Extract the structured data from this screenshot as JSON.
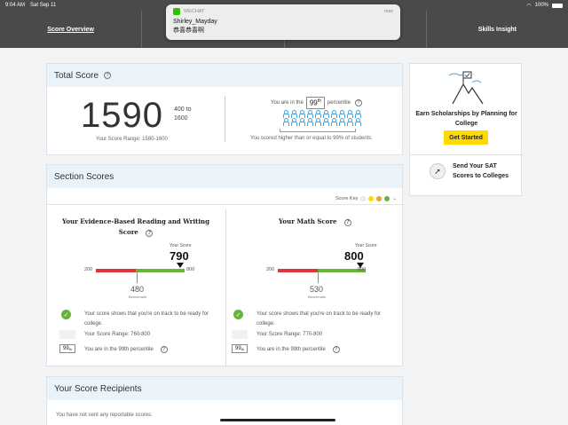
{
  "status_bar": {
    "time": "9:04 AM",
    "date": "Sat Sep 11",
    "battery": "100%"
  },
  "nav": {
    "tabs": [
      {
        "label": "Score Overview"
      },
      {
        "label": ""
      },
      {
        "label": ""
      },
      {
        "label": "Skills Insight"
      }
    ]
  },
  "notification": {
    "app": "WECHAT",
    "time": "now",
    "sender": "Shirley_Mayday",
    "message": "恭喜恭喜啊"
  },
  "total": {
    "title": "Total Score",
    "score": "1590",
    "range_top": "400 to",
    "range_bottom": "1600",
    "score_range": "Your Score Range: 1580-1600",
    "percentile_prefix": "You are in the",
    "percentile": "99",
    "percentile_sup": "th",
    "percentile_suffix": "percentile",
    "caption": "You scored higher than or equal to 99% of students."
  },
  "sidebar": {
    "title": "Earn Scholarships by Planning for College",
    "button": "Get Started",
    "send_text": "Send Your SAT Scores to Colleges"
  },
  "section": {
    "title": "Section Scores",
    "score_key": "Score Key",
    "key_colors": [
      "#f0f0f0",
      "#fedb00",
      "#e8a23b",
      "#66b538"
    ],
    "reading": {
      "title": "Your Evidence-Based Reading and Writing Score",
      "your_score_label": "Your Score",
      "score": "790",
      "min": "200",
      "max": "800",
      "benchmark": "480",
      "benchmark_label": "Benchmark",
      "on_track": "Your score shows that you're on track to be ready for college.",
      "range": "Your Score Range: 760-800",
      "pct_box": "99",
      "pct_sup": "th",
      "pct_text": "You are in the 99th percentile"
    },
    "math": {
      "title": "Your Math Score",
      "your_score_label": "Your Score",
      "score": "800",
      "min": "200",
      "max": "800",
      "benchmark": "530",
      "benchmark_label": "Benchmark",
      "on_track": "Your score shows that you're on track to be ready for college.",
      "range": "Your Score Range: 770-800",
      "pct_box": "99",
      "pct_sup": "th",
      "pct_text": "You are in the 99th percentile"
    }
  },
  "recipients": {
    "title": "Your Score Recipients",
    "text": "You have not sent any reportable scores."
  }
}
